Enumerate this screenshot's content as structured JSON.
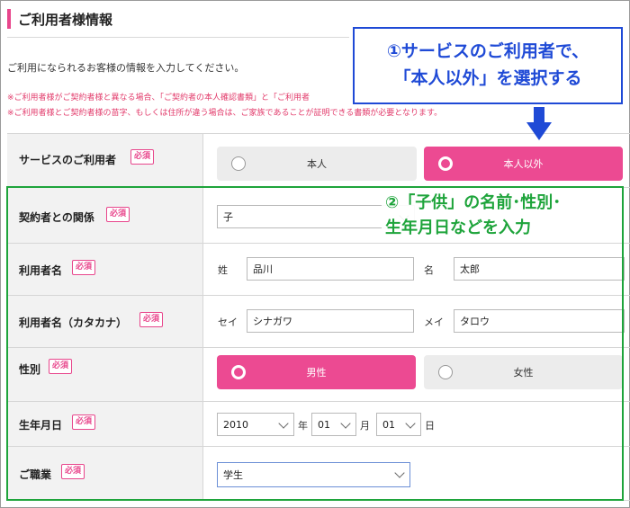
{
  "section": {
    "title": "ご利用者様情報"
  },
  "intro": "ご利用になられるお客様の情報を入力してください。",
  "notes": [
    "※ご利用者様がご契約者様と異なる場合、「ご契約者の本人確認書類」と「ご利用者",
    "※ご利用者様とご契約者様の苗字、もしくは住所が違う場合は、ご家族であることが証明できる書類が必要となります。"
  ],
  "required_badge": "必須",
  "callout1": {
    "line1": "①サービスのご利用者で、",
    "line2": "「本人以外」を選択する"
  },
  "callout2": {
    "line1": "②「子供」の名前･性別･",
    "line2": "生年月日などを入力"
  },
  "fields": {
    "user_type": {
      "label": "サービスのご利用者",
      "options": [
        "本人",
        "本人以外"
      ],
      "selected": "本人以外"
    },
    "relationship": {
      "label": "契約者との関係",
      "value": "子"
    },
    "name": {
      "label": "利用者名",
      "sei_label": "姓",
      "sei_value": "品川",
      "mei_label": "名",
      "mei_value": "太郎"
    },
    "kana": {
      "label": "利用者名（カタカナ）",
      "sei_label": "セイ",
      "sei_value": "シナガワ",
      "mei_label": "メイ",
      "mei_value": "タロウ"
    },
    "gender": {
      "label": "性別",
      "options": [
        "男性",
        "女性"
      ],
      "selected": "男性"
    },
    "birthday": {
      "label": "生年月日",
      "year": "2010",
      "year_unit": "年",
      "month": "01",
      "month_unit": "月",
      "day": "01",
      "day_unit": "日"
    },
    "occupation": {
      "label": "ご職業",
      "value": "学生"
    }
  },
  "colors": {
    "accent": "#ec4a92",
    "callout_blue": "#1f4ad6",
    "callout_green": "#1ea43b"
  }
}
